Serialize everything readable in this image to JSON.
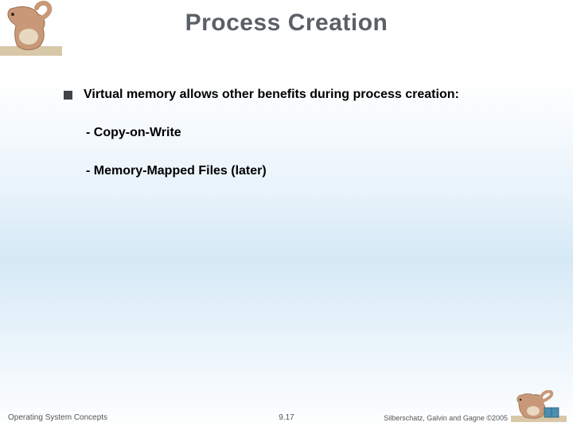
{
  "title": "Process Creation",
  "bullet": "Virtual memory allows other benefits during process creation:",
  "sub1": "- Copy-on-Write",
  "sub2": "- Memory-Mapped Files (later)",
  "footer": {
    "left": "Operating System Concepts",
    "center": "9.17",
    "right": "Silberschatz, Galvin and Gagne ©2005"
  },
  "logo": {
    "bodyColor": "#c89878",
    "bellyColor": "#e8d8c0",
    "bookColor": "#4a8fb0"
  }
}
